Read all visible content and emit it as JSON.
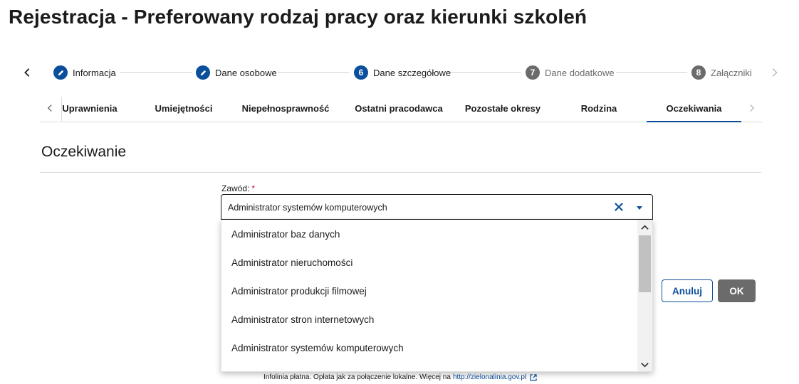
{
  "page": {
    "title": "Rejestracja - Preferowany rodzaj pracy oraz kierunki szkoleń"
  },
  "stepper": {
    "steps": [
      {
        "number": "",
        "label": "Informacja",
        "state": "done",
        "icon": "pencil-icon"
      },
      {
        "number": "",
        "label": "Dane osobowe",
        "state": "done",
        "icon": "pencil-icon"
      },
      {
        "number": "6",
        "label": "Dane szczegółowe",
        "state": "active"
      },
      {
        "number": "7",
        "label": "Dane dodatkowe",
        "state": "todo"
      },
      {
        "number": "8",
        "label": "Załączniki",
        "state": "todo"
      }
    ]
  },
  "subtabs": {
    "items": [
      {
        "label": "Uprawnienia"
      },
      {
        "label": "Umiejętności"
      },
      {
        "label": "Niepełnosprawność"
      },
      {
        "label": "Ostatni pracodawca"
      },
      {
        "label": "Pozostałe okresy"
      },
      {
        "label": "Rodzina"
      },
      {
        "label": "Oczekiwania",
        "active": true
      }
    ]
  },
  "section": {
    "title": "Oczekiwanie"
  },
  "field": {
    "label": "Zawód:",
    "required_mark": "*",
    "value": "Administrator systemów komputerowych"
  },
  "dropdown": {
    "options": [
      "Administrator baz danych",
      "Administrator nieruchomości",
      "Administrator produkcji filmowej",
      "Administrator stron internetowych",
      "Administrator systemów komputerowych"
    ]
  },
  "buttons": {
    "cancel": "Anuluj",
    "ok": "OK"
  },
  "footer": {
    "note": "Infolinia płatna. Opłata jak za połączenie lokalne. Więcej na",
    "link": "http://zielonalinia.gov.pl"
  },
  "colors": {
    "primary": "#0b4f9c",
    "muted": "#6b6b6b",
    "required": "#c8102e",
    "text": "#1b1b1b"
  }
}
